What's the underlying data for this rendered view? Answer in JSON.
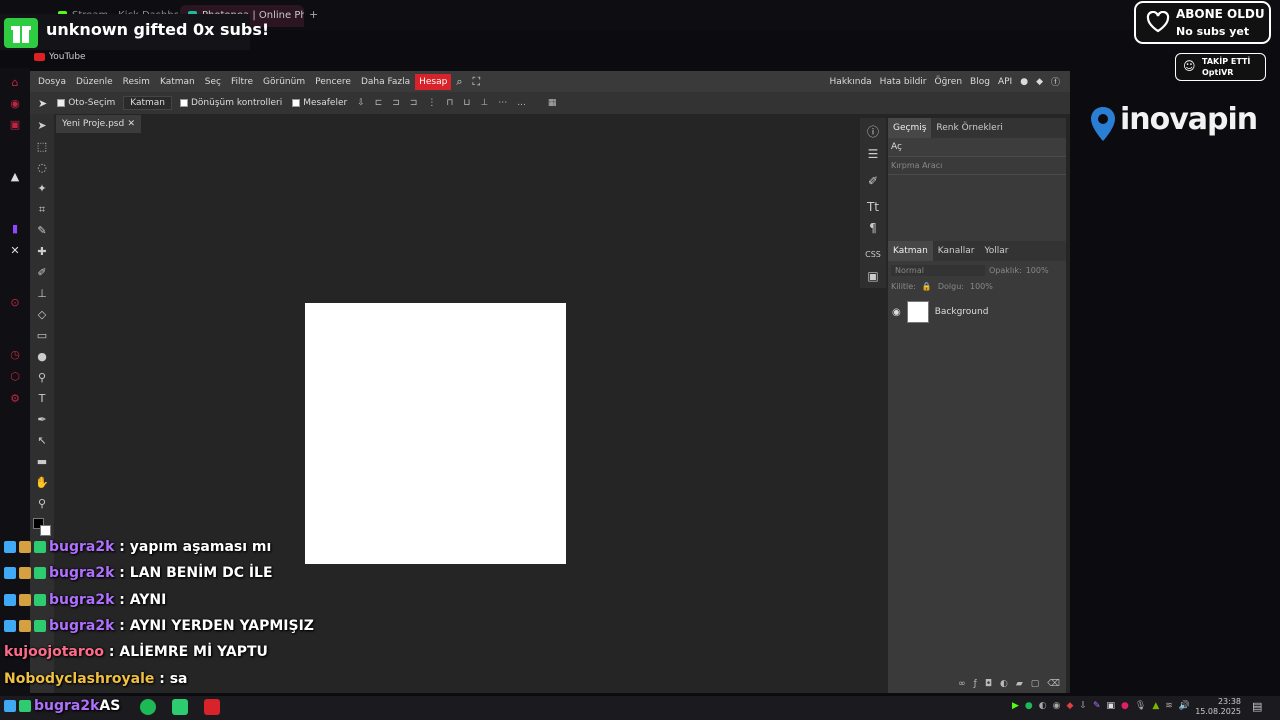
{
  "browser": {
    "tabs": [
      {
        "label": "Stream - Kick Dashboard",
        "color": "#53fc18"
      },
      {
        "label": "Photopea | Online Photo E",
        "color": "#1abc9c"
      }
    ],
    "new_tab": "+",
    "bookmark": "YouTube"
  },
  "alerts": {
    "gift_text": "unknown gifted 0x subs!",
    "abone_title": "ABONE OLDU",
    "abone_sub": "No subs yet",
    "takip_title": "TAKİP ETTİ",
    "takip_sub": "OptiVR"
  },
  "brand": {
    "name": "inovapin",
    "color": "#2a7fd4"
  },
  "menu": {
    "items": [
      "Dosya",
      "Düzenle",
      "Resim",
      "Katman",
      "Seç",
      "Filtre",
      "Görünüm",
      "Pencere",
      "Daha Fazla",
      "Hesap"
    ],
    "right": [
      "Hakkında",
      "Hata bildir",
      "Öğren",
      "Blog",
      "API"
    ]
  },
  "options": {
    "autoselect": "Oto-Seçim",
    "layer_select": "Katman",
    "transform": "Dönüşüm kontrolleri",
    "distances": "Mesafeler",
    "more": "..."
  },
  "document": {
    "tab": "Yeni Proje.psd",
    "close": "✕"
  },
  "history_panel": {
    "tabs": [
      "Geçmiş",
      "Renk Örnekleri"
    ],
    "items": [
      "Aç",
      "Kırpma Aracı"
    ]
  },
  "layers_panel": {
    "tabs": [
      "Katman",
      "Kanallar",
      "Yollar"
    ],
    "blend": "Normal",
    "opacity_label": "Opaklık:",
    "opacity": "100%",
    "lock_label": "Kilitle:",
    "fill_label": "Dolgu:",
    "fill": "100%",
    "layer_name": "Background"
  },
  "chat": [
    {
      "user": "bugra2k",
      "msg": ": yapım aşaması mı",
      "color": "#b070ff"
    },
    {
      "user": "bugra2k",
      "msg": ": LAN BENİM DC İLE",
      "color": "#b070ff"
    },
    {
      "user": "bugra2k",
      "msg": ": AYNI",
      "color": "#b070ff"
    },
    {
      "user": "bugra2k",
      "msg": ": AYNI YERDEN YAPMIŞIZ",
      "color": "#b070ff"
    },
    {
      "user": "kujoojotaroo",
      "msg": ": ALİEMRE Mİ YAPTU",
      "color": "#ff6b8a"
    },
    {
      "user": "Nobodyclashroyale",
      "msg": ": sa",
      "color": "#f0c040"
    },
    {
      "user": "bugra2k",
      "msg": "AS",
      "color": "#b070ff"
    }
  ],
  "clock": {
    "time": "23:38",
    "date": "15.08.2025"
  }
}
